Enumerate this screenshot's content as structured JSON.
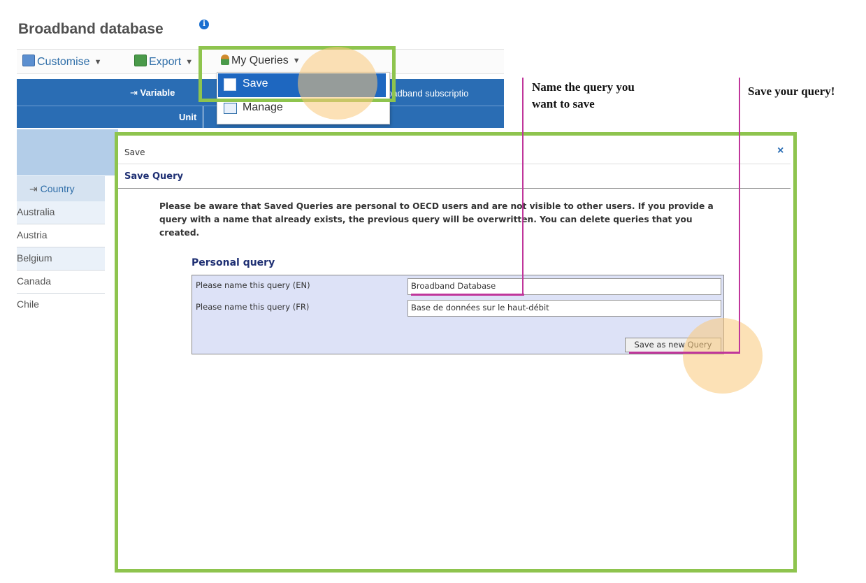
{
  "page": {
    "title": "Broadband database"
  },
  "toolbar": {
    "customise_label": "Customise",
    "export_label": "Export",
    "my_queries_label": "My Queries"
  },
  "table": {
    "variable_label": "Variable",
    "unit_label": "Unit",
    "header_truncated": "oadband subscriptio",
    "country_label": "Country",
    "countries": [
      "Australia",
      "Austria",
      "Belgium",
      "Canada",
      "Chile"
    ]
  },
  "dropdown": {
    "save_label": "Save",
    "manage_label": "Manage"
  },
  "modal": {
    "title": "Save",
    "close_glyph": "×",
    "heading": "Save Query",
    "notice": "Please be aware that Saved Queries are personal to OECD users and are not visible to other users. If you provide a query with a name that already exists, the previous query will be overwritten. You can delete queries that you created.",
    "section_heading": "Personal query",
    "label_en": "Please name this query (EN)",
    "label_fr": "Please name this query (FR)",
    "value_en": "Broadband Database",
    "value_fr": "Base de données sur le haut-débit",
    "button_label": "Save as new Query"
  },
  "annotations": {
    "name_query_line1": "Name the query you",
    "name_query_line2": "want to save",
    "save_query": "Save your query!"
  },
  "colors": {
    "highlight_green": "#8ec44e",
    "header_blue": "#2a6db4",
    "menu_selected": "#1e67c0",
    "annotation_line": "#c0369b",
    "highlight_circle": "#f9c97a"
  },
  "icons": {
    "info": "info-icon",
    "customise": "customise-icon",
    "export": "export-icon",
    "my_queries": "user-icon",
    "save": "save-icon",
    "manage": "manage-icon",
    "close": "close-icon"
  }
}
